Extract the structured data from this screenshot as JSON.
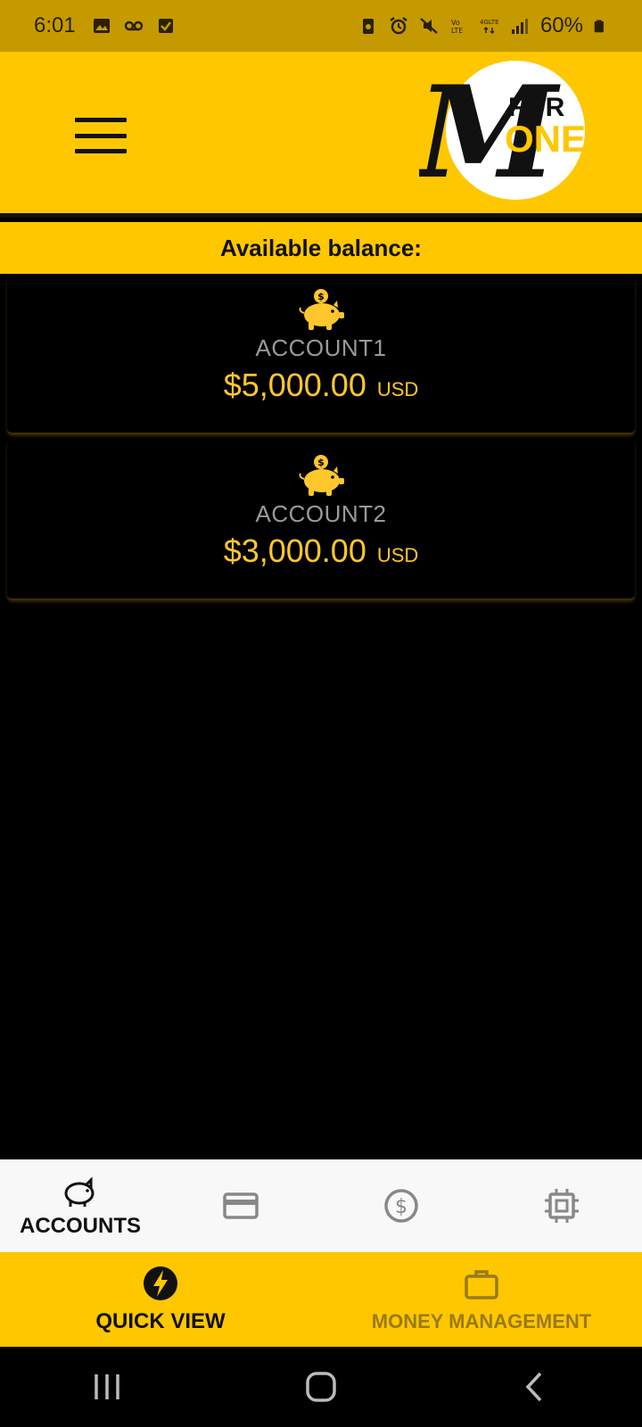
{
  "status_bar": {
    "time": "6:01",
    "battery_text": "60%",
    "left_icons": [
      "image-icon",
      "voicemail-icon",
      "checkbox-icon"
    ],
    "right_icons": [
      "battery-saver-icon",
      "alarm-icon",
      "mute-icon",
      "volte-icon",
      "4g-lte-icon",
      "signal-icon",
      "battery-icon"
    ]
  },
  "header": {
    "logo": {
      "big_letter": "M",
      "word_top": "FOR",
      "word_bottom": "ONEY"
    },
    "brand_color": "#ffc700"
  },
  "balance": {
    "label": "Available balance:"
  },
  "accounts": [
    {
      "name": "ACCOUNT1",
      "amount": "$5,000.00",
      "currency": "USD",
      "icon": "piggy-bank-icon"
    },
    {
      "name": "ACCOUNT2",
      "amount": "$3,000.00",
      "currency": "USD",
      "icon": "piggy-bank-icon"
    }
  ],
  "tabs": [
    {
      "label": "ACCOUNTS",
      "icon": "piggy-bank-icon",
      "active": true
    },
    {
      "label": "",
      "icon": "credit-card-icon",
      "active": false
    },
    {
      "label": "",
      "icon": "dollar-circle-icon",
      "active": false
    },
    {
      "label": "",
      "icon": "chip-icon",
      "active": false
    }
  ],
  "sections": [
    {
      "label": "QUICK VIEW",
      "icon": "bolt-icon",
      "active": true
    },
    {
      "label": "MONEY MANAGEMENT",
      "icon": "briefcase-icon",
      "active": false
    }
  ],
  "system_nav": [
    "recents-icon",
    "home-icon",
    "back-icon"
  ],
  "colors": {
    "accent": "#ffc700",
    "status_bar": "#c49a00",
    "amount": "#ffc72c",
    "inactive_section": "#9a7a1a"
  }
}
